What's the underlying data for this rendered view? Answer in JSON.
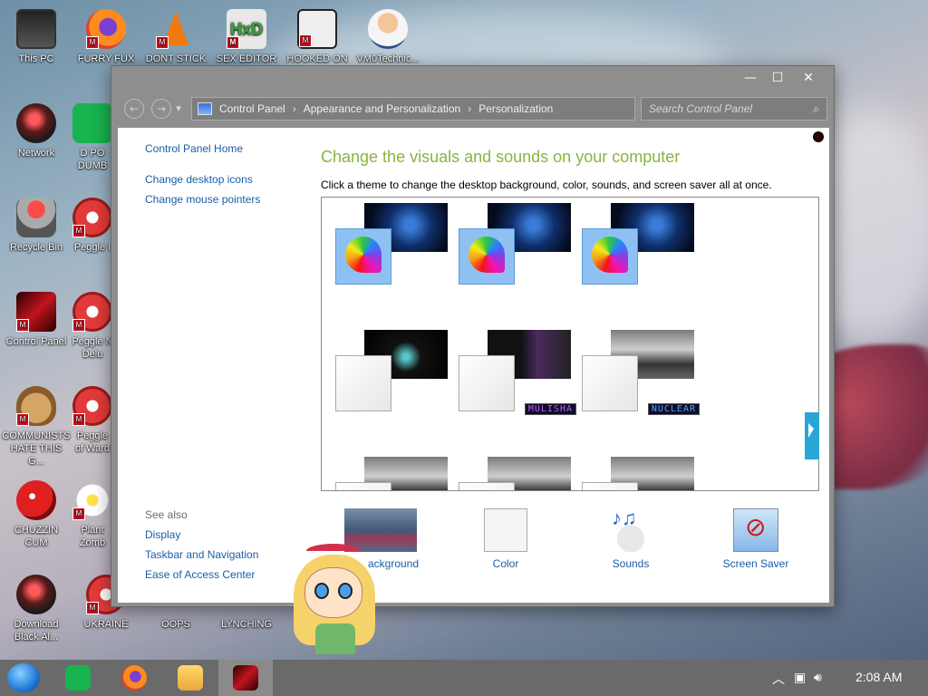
{
  "desktop": {
    "icons": [
      {
        "label": "This PC",
        "icon": "pc-icon"
      },
      {
        "label": "FURRY FUX",
        "icon": "firefox-icon"
      },
      {
        "label": "DONT STICK",
        "icon": "vlc-cone-icon"
      },
      {
        "label": "SEX EDITOR",
        "icon": "hxd-icon"
      },
      {
        "label": "HOOKED ON",
        "icon": "maze-icon"
      },
      {
        "label": "VM0Technic...",
        "icon": "doctor-icon"
      },
      {
        "label": "Network",
        "icon": "network-icon"
      },
      {
        "label": "D PO DUMB",
        "icon": "green-app-icon"
      },
      {
        "label": "Recycle Bin",
        "icon": "recycle-bin-icon"
      },
      {
        "label": "Peggle I",
        "icon": "peggle-icon"
      },
      {
        "label": "Control Panel",
        "icon": "control-panel-icon"
      },
      {
        "label": "Peggle N Delu",
        "icon": "peggle-icon"
      },
      {
        "label": "COMMUNISTS HATE THIS G...",
        "icon": "money-bag-icon"
      },
      {
        "label": "Peggle of Ward",
        "icon": "peggle-icon"
      },
      {
        "label": "CHUZZIN CUM",
        "icon": "chuzzle-icon"
      },
      {
        "label": "Plant Zomb",
        "icon": "flower-icon"
      },
      {
        "label": "Download Black Al...",
        "icon": "network-icon"
      },
      {
        "label": "UKRAINE",
        "icon": "ukraine-icon"
      },
      {
        "label": "OOPS",
        "icon": "oops-icon"
      },
      {
        "label": "LYNCHING",
        "icon": "lynching-icon"
      }
    ]
  },
  "window": {
    "controls": {
      "minimize": "—",
      "maximize": "☐",
      "close": "✕"
    },
    "nav": {
      "back": "←",
      "forward": "→",
      "dropdown": "▾"
    },
    "breadcrumb": [
      "Control Panel",
      "Appearance and Personalization",
      "Personalization"
    ],
    "breadcrumb_sep": "›",
    "search_placeholder": "Search Control Panel",
    "search_icon": "⌕",
    "left_nav": [
      "Control Panel Home",
      "Change desktop icons",
      "Change mouse pointers"
    ],
    "see_also": {
      "heading": "See also",
      "links": [
        "Display",
        "Taskbar and Navigation",
        "Ease of Access Center"
      ]
    },
    "title": "Change the visuals and sounds on your computer",
    "subtitle": "Click a theme to change the desktop background, color, sounds, and screen saver all at once.",
    "theme_tags": [
      "MULISHA",
      "NUCLEAR"
    ],
    "bottom_items": [
      {
        "label": "Desktop Background",
        "visible_label": "ackground"
      },
      {
        "label": "Color"
      },
      {
        "label": "Sounds"
      },
      {
        "label": "Screen Saver"
      }
    ]
  },
  "taskbar": {
    "time": "2:08 AM",
    "tray_icons": [
      "chevron-up-icon",
      "network-icon",
      "volume-icon"
    ]
  }
}
